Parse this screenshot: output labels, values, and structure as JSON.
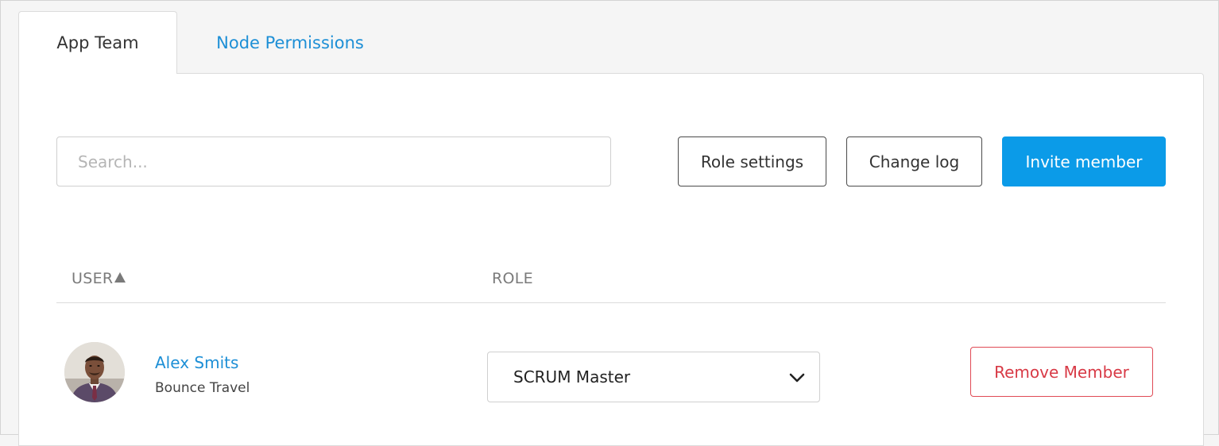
{
  "tabs": [
    {
      "label": "App Team",
      "active": true
    },
    {
      "label": "Node Permissions",
      "active": false
    }
  ],
  "toolbar": {
    "search_placeholder": "Search...",
    "role_settings_label": "Role settings",
    "change_log_label": "Change log",
    "invite_member_label": "Invite member"
  },
  "table": {
    "columns": [
      {
        "label": "USER",
        "sort": "ascending",
        "sort_icon": "triangle-up-icon"
      },
      {
        "label": "ROLE"
      }
    ],
    "rows": [
      {
        "avatar": "avatar-photo",
        "name": "Alex Smits",
        "company": "Bounce Travel",
        "role": "SCRUM Master",
        "role_select_icon": "chevron-down-icon",
        "remove_label": "Remove Member"
      }
    ]
  },
  "colors": {
    "accent": "#0b9be8",
    "link": "#1d8fd6",
    "danger": "#d83a46",
    "header_text": "#7a7a7a"
  }
}
